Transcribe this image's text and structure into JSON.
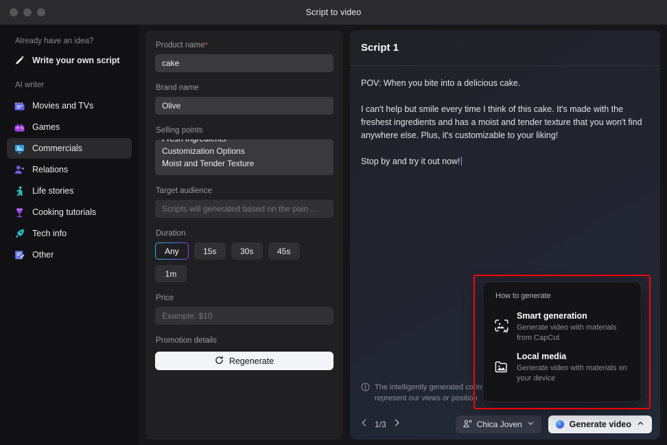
{
  "window": {
    "title": "Script to video",
    "controls": [
      "close",
      "minimize",
      "maximize"
    ]
  },
  "sidebar": {
    "section_idea_label": "Already have an idea?",
    "write_own": {
      "label": "Write your own script",
      "icon": "pencil-icon"
    },
    "section_ai_label": "AI writer",
    "items": [
      {
        "label": "Movies and TVs",
        "icon": "clapperboard-icon",
        "color": "#5b64e8",
        "active": false
      },
      {
        "label": "Games",
        "icon": "game-console-icon",
        "color": "#a23ee8",
        "active": false
      },
      {
        "label": "Commercials",
        "icon": "billboard-icon",
        "color": "#2f9fe8",
        "active": true
      },
      {
        "label": "Relations",
        "icon": "person-heart-icon",
        "color": "#6b5ce8",
        "active": false
      },
      {
        "label": "Life stories",
        "icon": "person-walk-icon",
        "color": "#22c8c8",
        "active": false
      },
      {
        "label": "Cooking tutorials",
        "icon": "wine-glass-icon",
        "color": "#9b3ee8",
        "active": false
      },
      {
        "label": "Tech info",
        "icon": "rocket-icon",
        "color": "#22c8d8",
        "active": false
      },
      {
        "label": "Other",
        "icon": "note-edit-icon",
        "color": "#6b7ae8",
        "active": false
      }
    ]
  },
  "form": {
    "product_name": {
      "label": "Product name",
      "required_mark": "*",
      "value": "cake"
    },
    "brand_name": {
      "label": "Brand name",
      "value": "Olive"
    },
    "selling_points": {
      "label": "Selling points",
      "lines": [
        "Fresh Ingredients",
        "Customization Options",
        "Moist and Tender Texture"
      ]
    },
    "target_audience": {
      "label": "Target audience",
      "placeholder": "Scripts will generated based on the pain ..."
    },
    "duration": {
      "label": "Duration",
      "options": [
        "Any",
        "15s",
        "30s",
        "45s",
        "1m"
      ],
      "selected": "Any"
    },
    "price": {
      "label": "Price",
      "placeholder": "Example: $10"
    },
    "promotion_details": {
      "label": "Promotion details"
    },
    "regenerate": {
      "label": "Regenerate",
      "icon": "refresh-icon"
    }
  },
  "script": {
    "title": "Script 1",
    "paragraphs": [
      "POV: When you bite into a delicious cake.",
      "I can't help but smile every time I think of this cake. It's made with the freshest ingredients and has a moist and tender texture that you won't find anywhere else. Plus, it's customizable to your liking!",
      "Stop by and try it out now!"
    ],
    "disclaimer": "The intelligently generated content is for reference purposes only and does not represent our views or position",
    "disclaimer_icon": "info-icon",
    "pagination": {
      "current": "1/3",
      "prev_icon": "chevron-left-icon",
      "next_icon": "chevron-right-icon"
    },
    "voice": {
      "label": "Chica Joven",
      "icon": "voice-person-icon",
      "chevron": "chevron-down-icon"
    },
    "generate": {
      "label": "Generate video",
      "icon": "ai-orb-icon",
      "chevron": "chevron-up-icon"
    }
  },
  "popup": {
    "title": "How to generate",
    "options": [
      {
        "name": "Smart generation",
        "desc": "Generate video with materials from CapCut",
        "icon": "ai-frame-icon"
      },
      {
        "name": "Local media",
        "desc": "Generate video with materials on your device",
        "icon": "media-folder-icon"
      }
    ],
    "highlight_color": "#ff0000"
  }
}
